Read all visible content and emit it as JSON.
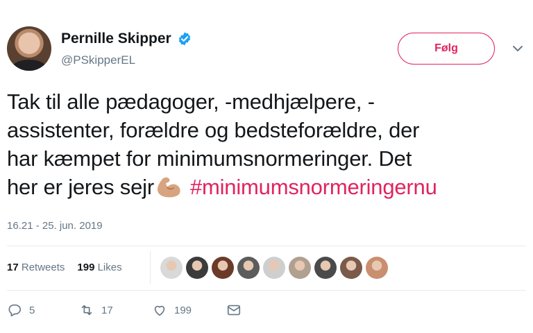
{
  "author": {
    "name": "Pernille Skipper",
    "handle": "@PSkipperEL",
    "verified": true
  },
  "follow_button": {
    "label": "Følg",
    "color": "#e0245e"
  },
  "tweet": {
    "lines": [
      "Tak til alle pædagoger, -medhjælpere, -",
      "assistenter, forældre og bedsteforældre, der",
      "har kæmpet for minimumsnormeringer. Det",
      "her er jeres sejr"
    ],
    "emoji": "flexed-biceps-icon",
    "hashtag": "#minimumsnormeringernu",
    "hashtag_color": "#e0245e",
    "timestamp": "16.21 - 25. jun. 2019"
  },
  "stats": {
    "retweets_count": "17",
    "retweets_label": "Retweets",
    "likes_count": "199",
    "likes_label": "Likes"
  },
  "likers": [
    {
      "name": "liker-avatar-1",
      "color": "#d9d9d9"
    },
    {
      "name": "liker-avatar-2",
      "color": "#3b3b3b"
    },
    {
      "name": "liker-avatar-3",
      "color": "#6b3b2a"
    },
    {
      "name": "liker-avatar-4",
      "color": "#5c5c5c"
    },
    {
      "name": "liker-avatar-5",
      "color": "#cfcfcf"
    },
    {
      "name": "liker-avatar-6",
      "color": "#b0a090"
    },
    {
      "name": "liker-avatar-7",
      "color": "#4a4a4a"
    },
    {
      "name": "liker-avatar-8",
      "color": "#7a5a4a"
    },
    {
      "name": "liker-avatar-9",
      "color": "#c98f6f"
    }
  ],
  "actions": {
    "replies": "5",
    "retweets": "17",
    "likes": "199"
  }
}
